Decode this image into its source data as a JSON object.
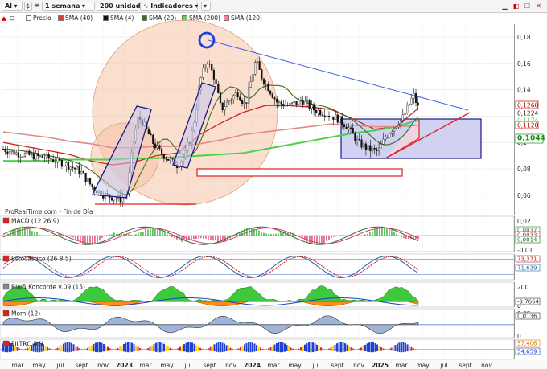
{
  "toolbar": {
    "symbol": "Al",
    "period": "1 semana",
    "units": "200 unidades",
    "indicators": "Indicadores"
  },
  "legend": [
    {
      "label": "Precio",
      "color": "#ffffff"
    },
    {
      "label": "SMA (40)",
      "color": "#e23b3b"
    },
    {
      "label": "SMA (4)",
      "color": "#111111"
    },
    {
      "label": "SMA (20)",
      "color": "#3c6e1e"
    },
    {
      "label": "SMA (200)",
      "color": "#5fd35f"
    },
    {
      "label": "SMA (120)",
      "color": "#ff7f9a"
    }
  ],
  "main": {
    "source": "ProRealTime.com - Fin de Día",
    "y_ticks": [
      "0,18",
      "0,16",
      "0,14",
      "0,12",
      "0,1",
      "0,08",
      "0,06"
    ],
    "price_labels": [
      {
        "text": "0,1260",
        "bg": "#ffffff",
        "fg": "#b00000",
        "border": "#d00000"
      },
      {
        "text": "0,1224",
        "bg": "#ffffff",
        "fg": "#222222",
        "border": "#ffffff"
      },
      {
        "text": "0,1174",
        "bg": "#ffffff",
        "fg": "#5fd35f",
        "border": "#ffffff"
      },
      {
        "text": "0,1120",
        "bg": "#ffffff",
        "fg": "#b00000",
        "border": "#d00000"
      },
      {
        "text": "0,1044",
        "bg": "#ffffff",
        "fg": "#1a8a1a",
        "border": "#1a8a1a"
      }
    ]
  },
  "x_ticks": [
    "mar",
    "may",
    "jul",
    "sept",
    "nov",
    "2023",
    "mar",
    "may",
    "jul",
    "sept",
    "nov",
    "2024",
    "mar",
    "may",
    "jul",
    "sept",
    "nov",
    "2025",
    "mar",
    "may",
    "jul",
    "sept",
    "nov"
  ],
  "panels": {
    "macd": {
      "title": "MACD (12 26 9)",
      "ticks": [
        "0,02",
        "0",
        "-0,01"
      ],
      "values": [
        "0,0037",
        "0,0033",
        "0,0014"
      ]
    },
    "stoch": {
      "title": "Estocástico (26 8 5)",
      "values": [
        "73,371",
        "71,639"
      ]
    },
    "koncorde": {
      "title": "Blai5 Koncorde v.09 (15)",
      "ticks": [
        "200",
        "0"
      ],
      "values": [
        "-3,7664"
      ]
    },
    "mom": {
      "title": "Mom (12)",
      "ticks": [
        "0,05",
        "0"
      ],
      "values": [
        "0,0136"
      ]
    },
    "rsi": {
      "title": "FILTRO RSI",
      "values": [
        "57,406",
        "54,659"
      ]
    }
  },
  "chart_data": [
    {
      "type": "line",
      "title": "",
      "series_type": "candlestick (weekly)",
      "ylim": [
        0.05,
        0.19
      ],
      "x": [
        "2022-03",
        "2022-05",
        "2022-07",
        "2022-09",
        "2022-11",
        "2023-01",
        "2023-03",
        "2023-05",
        "2023-07",
        "2023-09",
        "2023-11",
        "2024-01",
        "2024-03",
        "2024-05",
        "2024-07",
        "2024-09",
        "2024-11",
        "2025-01",
        "2025-03",
        "2025-04"
      ],
      "series": [
        {
          "name": "Precio",
          "values": [
            0.093,
            0.09,
            0.084,
            0.078,
            0.068,
            0.057,
            0.12,
            0.088,
            0.083,
            0.155,
            0.115,
            0.162,
            0.127,
            0.128,
            0.127,
            0.118,
            0.107,
            0.093,
            0.11,
            0.122
          ]
        },
        {
          "name": "SMA (40)",
          "values": [
            0.1,
            0.097,
            0.094,
            0.091,
            0.086,
            0.083,
            0.085,
            0.09,
            0.092,
            0.106,
            0.115,
            0.123,
            0.128,
            0.128,
            0.127,
            0.125,
            0.118,
            0.11,
            0.112,
            0.126
          ]
        },
        {
          "name": "SMA (200)",
          "values": [
            0.086,
            0.086,
            0.086,
            0.087,
            0.087,
            0.087,
            0.088,
            0.088,
            0.089,
            0.09,
            0.091,
            0.092,
            0.095,
            0.098,
            0.101,
            0.104,
            0.107,
            0.109,
            0.112,
            0.117
          ]
        },
        {
          "name": "SMA (120)",
          "values": [
            0.108,
            0.106,
            0.104,
            0.101,
            0.099,
            0.096,
            0.096,
            0.097,
            0.097,
            0.099,
            0.102,
            0.106,
            0.108,
            0.11,
            0.112,
            0.114,
            0.113,
            0.112,
            0.112,
            0.113
          ]
        }
      ]
    }
  ]
}
